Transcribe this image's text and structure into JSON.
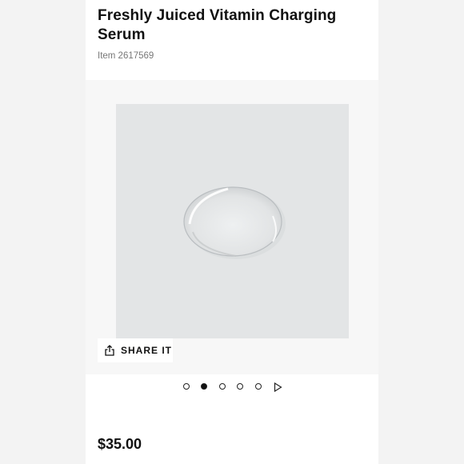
{
  "product": {
    "title": "Freshly Juiced Vitamin Charging Serum",
    "item_number": "Item 2617569",
    "price": "$35.00"
  },
  "gallery": {
    "share_label": "SHARE IT",
    "share_icon": "share-icon",
    "image_count": 5,
    "active_index": 1
  }
}
